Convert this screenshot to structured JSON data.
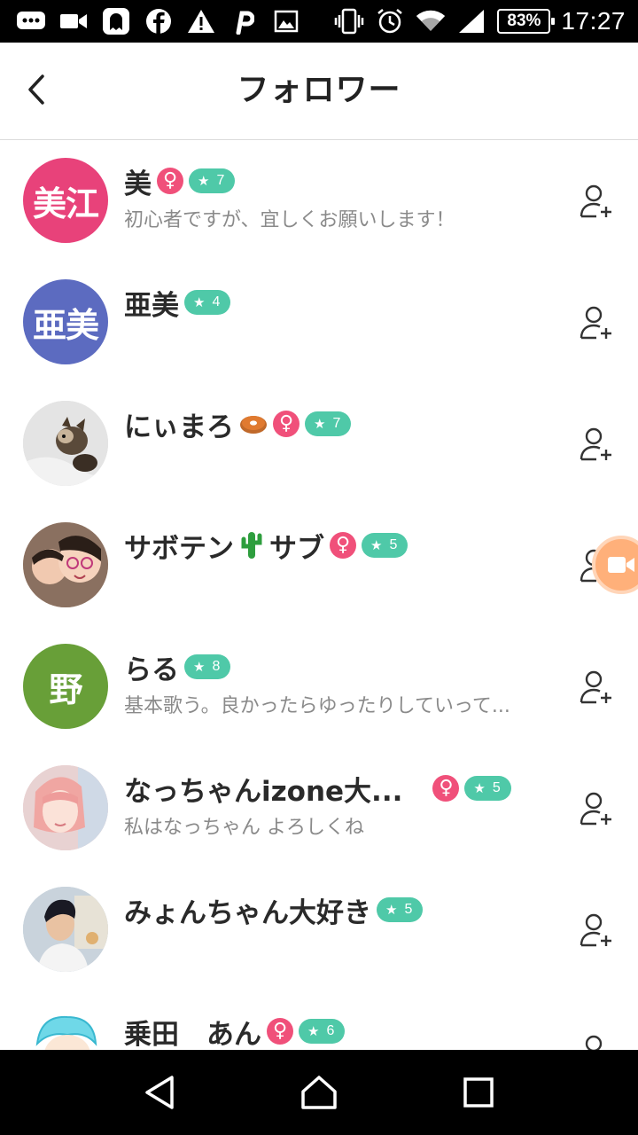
{
  "status_bar": {
    "battery": "83%",
    "battery_level": 0.83,
    "time": "17:27",
    "icons_left": [
      "chat-bubble-icon",
      "video-icon",
      "ghost-app-icon",
      "facebook-icon",
      "warning-icon",
      "p-app-icon",
      "image-icon"
    ],
    "icons_right": [
      "vibrate-icon",
      "alarm-icon",
      "wifi-icon",
      "signal-icon",
      "battery-icon"
    ]
  },
  "header": {
    "title": "フォロワー"
  },
  "colors": {
    "female_badge": "#f0507a",
    "level_badge": "#4fc9a8",
    "avatar_pink": "#e8427a",
    "avatar_indigo": "#5c6bc0",
    "avatar_green": "#689f38"
  },
  "followers": [
    {
      "name": "美",
      "female": "♀",
      "level": "7",
      "bio": "初心者ですが、宜しくお願いします！",
      "avatar_text": "美江",
      "avatar_color": "#e8427a"
    },
    {
      "name": "亜美",
      "female": "",
      "level": "4",
      "bio": "",
      "avatar_text": "亜美",
      "avatar_color": "#5c6bc0"
    },
    {
      "name": "にぃまろ",
      "emoji": "donut-emoji",
      "female": "♀",
      "level": "7",
      "bio": "",
      "avatar_text": "",
      "avatar_color": "#cfcfcf"
    },
    {
      "name": "サボテン",
      "emoji": "cactus-emoji",
      "name_suffix": "サブ",
      "female": "♀",
      "level": "5",
      "bio": "",
      "avatar_text": "",
      "avatar_color": "#d9b8a0"
    },
    {
      "name": "らる",
      "female": "",
      "level": "8",
      "bio": "基本歌う。良かったらゆったりしていって...",
      "avatar_text": "野",
      "avatar_color": "#689f38"
    },
    {
      "name": "なっちゃんizone大...",
      "female": "♀",
      "level": "5",
      "bio": "私はなっちゃん よろしくね",
      "avatar_text": "",
      "avatar_color": "#e9c3c6"
    },
    {
      "name": "みょんちゃん大好き",
      "female": "",
      "level": "5",
      "bio": "",
      "avatar_text": "",
      "avatar_color": "#b7c6d6"
    },
    {
      "name": "乗田　あん",
      "female": "♀",
      "level": "6",
      "bio": "",
      "avatar_text": "",
      "avatar_color": "#6fd8e8"
    }
  ],
  "nav": {
    "back": "back-triangle-icon",
    "home": "home-icon",
    "recents": "recents-square-icon"
  }
}
